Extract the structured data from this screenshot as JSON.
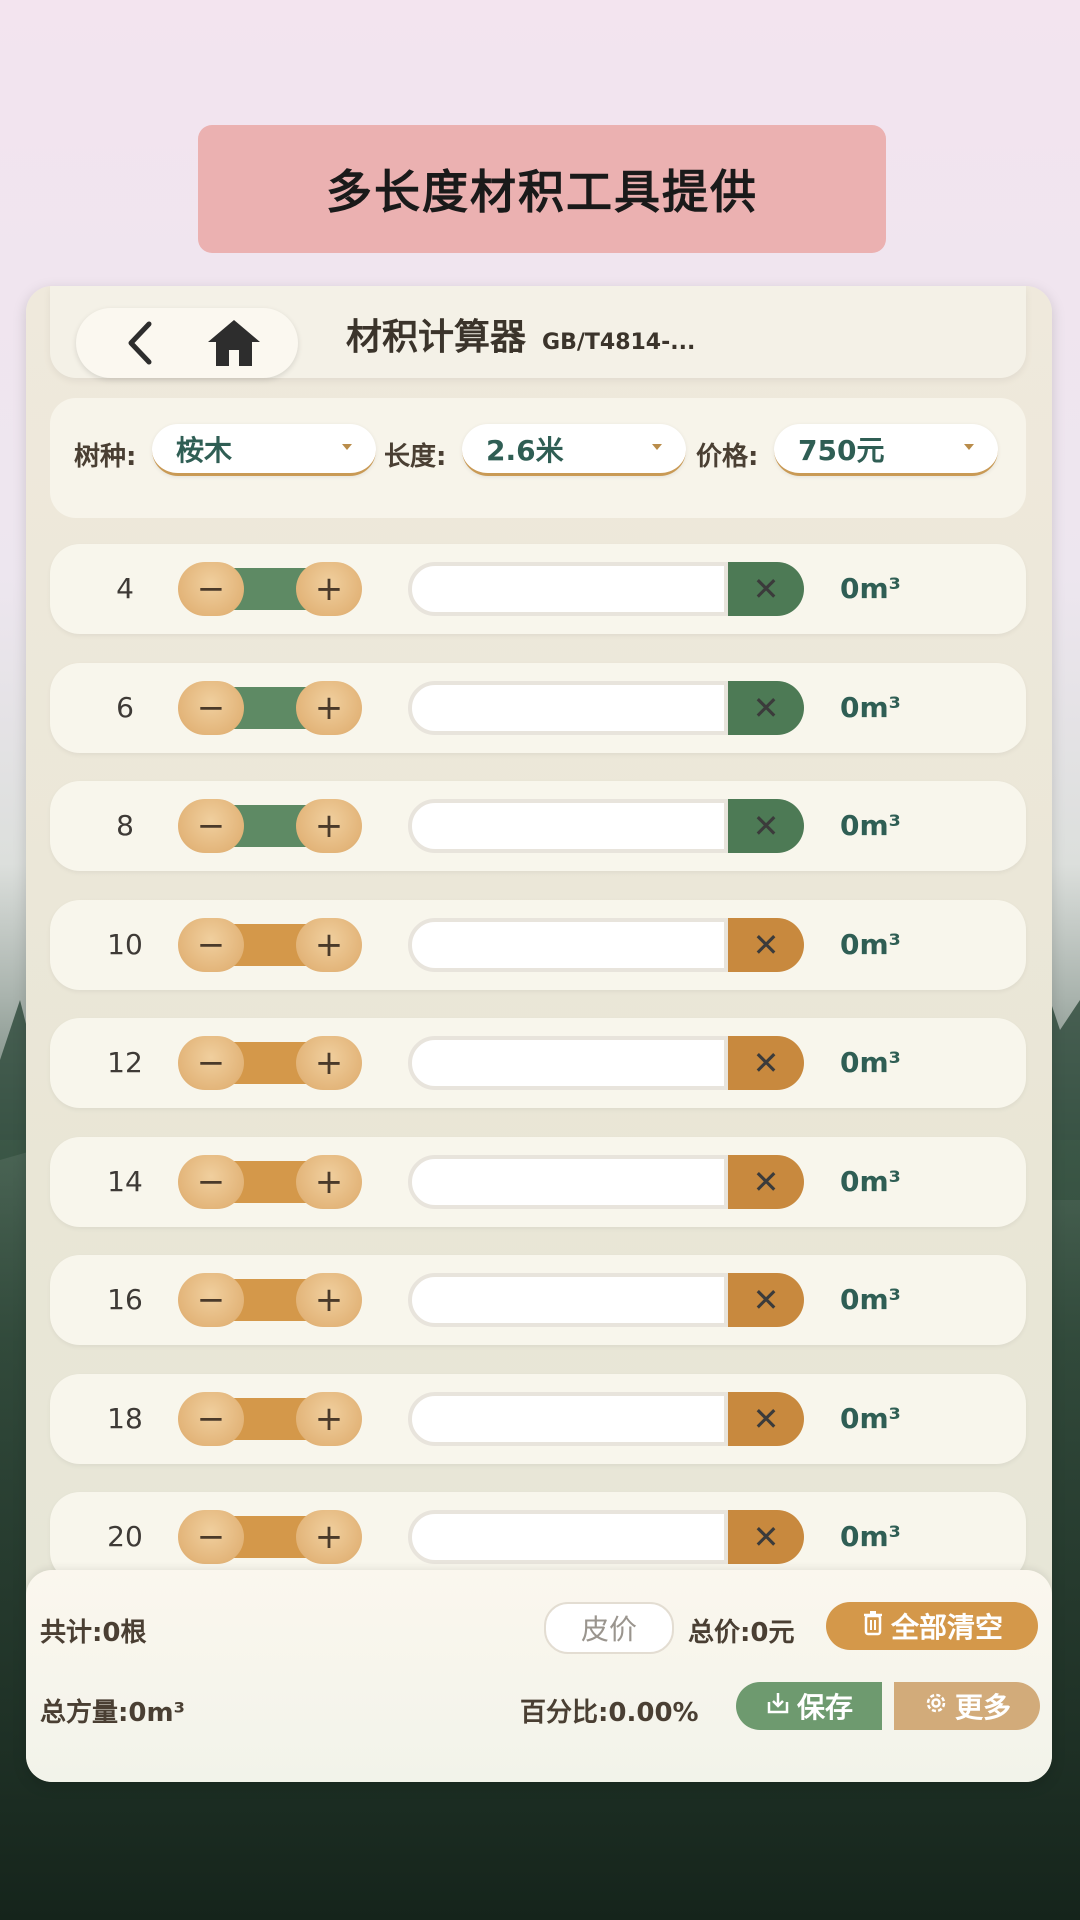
{
  "banner": {
    "text": "多长度材积工具提供"
  },
  "header": {
    "title": "材积计算器",
    "subtitle": "GB/T4814-...",
    "back_icon": "chevron-left-icon",
    "home_icon": "home-icon"
  },
  "selectors": {
    "species_label": "树种:",
    "species_value": "桉木",
    "length_label": "长度:",
    "length_value": "2.6米",
    "price_label": "价格:",
    "price_value": "750元"
  },
  "rows": [
    {
      "diameter": "4",
      "volume": "0m³",
      "theme": "green"
    },
    {
      "diameter": "6",
      "volume": "0m³",
      "theme": "green"
    },
    {
      "diameter": "8",
      "volume": "0m³",
      "theme": "green"
    },
    {
      "diameter": "10",
      "volume": "0m³",
      "theme": "orange"
    },
    {
      "diameter": "12",
      "volume": "0m³",
      "theme": "orange"
    },
    {
      "diameter": "14",
      "volume": "0m³",
      "theme": "orange"
    },
    {
      "diameter": "16",
      "volume": "0m³",
      "theme": "orange"
    },
    {
      "diameter": "18",
      "volume": "0m³",
      "theme": "orange"
    },
    {
      "diameter": "20",
      "volume": "0m³",
      "theme": "orange"
    }
  ],
  "stepper": {
    "minus": "−",
    "plus": "+",
    "clear": "✕"
  },
  "footer": {
    "total_count": "共计:0根",
    "tare_button": "皮价",
    "total_price": "总价:0元",
    "clear_all_button": "全部清空",
    "total_volume": "总方量:0m³",
    "percentage": "百分比:0.00%",
    "save_button": "保存",
    "more_button": "更多"
  },
  "colors": {
    "green": "#5e8a64",
    "green_dark": "#4d7a55",
    "orange": "#d4984a",
    "orange_dark": "#c8893e",
    "accent_text": "#2f5e54",
    "banner_bg": "#ebb1b1"
  }
}
